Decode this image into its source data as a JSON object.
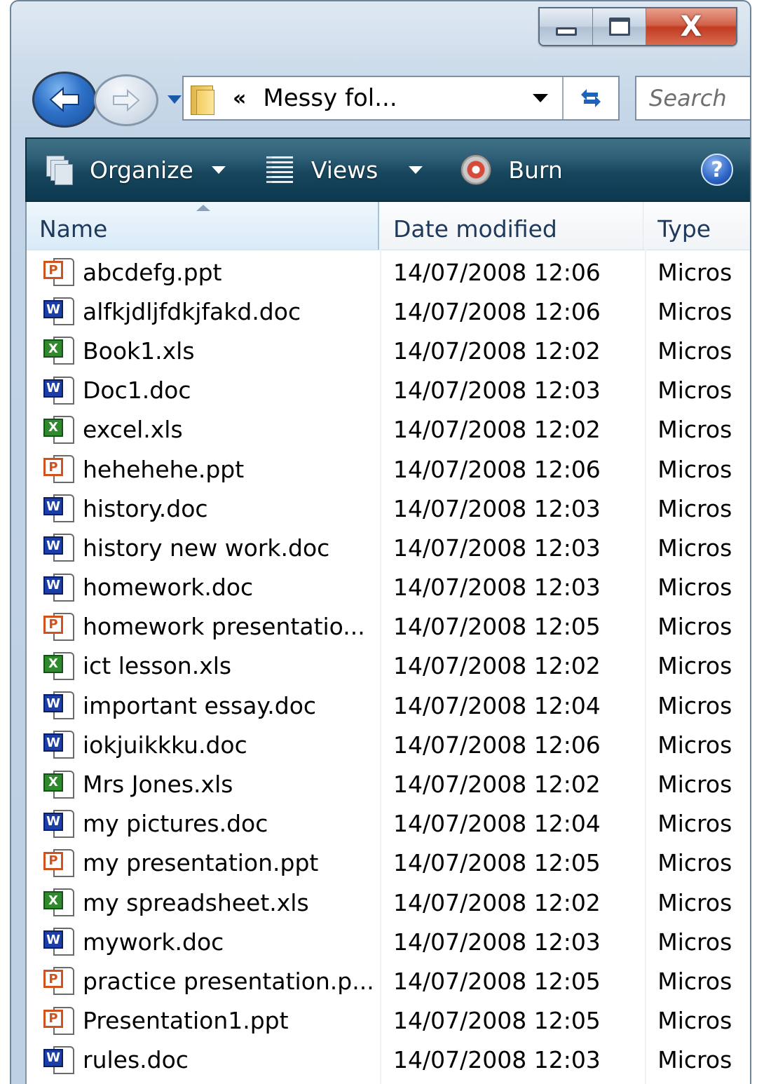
{
  "window": {
    "caption": {
      "minimize_icon": "minimize-icon",
      "maximize_icon": "maximize-icon",
      "close_glyph": "X"
    }
  },
  "nav": {
    "back_icon": "arrow-left-icon",
    "forward_icon": "arrow-right-icon",
    "address_chevron": "«",
    "address_text": "Messy fol...",
    "search_placeholder": "Search"
  },
  "toolbar": {
    "organize_label": "Organize",
    "views_label": "Views",
    "burn_label": "Burn",
    "help_glyph": "?"
  },
  "columns": {
    "name": "Name",
    "date": "Date modified",
    "type": "Type"
  },
  "files": [
    {
      "icon": "ppt",
      "name": "abcdefg.ppt",
      "date": "14/07/2008 12:06",
      "type": "Micros"
    },
    {
      "icon": "doc",
      "name": "alfkjdljfdkjfakd.doc",
      "date": "14/07/2008 12:06",
      "type": "Micros"
    },
    {
      "icon": "xls",
      "name": "Book1.xls",
      "date": "14/07/2008 12:02",
      "type": "Micros"
    },
    {
      "icon": "doc",
      "name": "Doc1.doc",
      "date": "14/07/2008 12:03",
      "type": "Micros"
    },
    {
      "icon": "xls",
      "name": "excel.xls",
      "date": "14/07/2008 12:02",
      "type": "Micros"
    },
    {
      "icon": "ppt",
      "name": "hehehehe.ppt",
      "date": "14/07/2008 12:06",
      "type": "Micros"
    },
    {
      "icon": "doc",
      "name": "history.doc",
      "date": "14/07/2008 12:03",
      "type": "Micros"
    },
    {
      "icon": "doc",
      "name": "history new work.doc",
      "date": "14/07/2008 12:03",
      "type": "Micros"
    },
    {
      "icon": "doc",
      "name": "homework.doc",
      "date": "14/07/2008 12:03",
      "type": "Micros"
    },
    {
      "icon": "ppt",
      "name": "homework presentatio...",
      "date": "14/07/2008 12:05",
      "type": "Micros"
    },
    {
      "icon": "xls",
      "name": "ict lesson.xls",
      "date": "14/07/2008 12:02",
      "type": "Micros"
    },
    {
      "icon": "doc",
      "name": "important essay.doc",
      "date": "14/07/2008 12:04",
      "type": "Micros"
    },
    {
      "icon": "doc",
      "name": "iokjuikkku.doc",
      "date": "14/07/2008 12:06",
      "type": "Micros"
    },
    {
      "icon": "xls",
      "name": "Mrs Jones.xls",
      "date": "14/07/2008 12:02",
      "type": "Micros"
    },
    {
      "icon": "doc",
      "name": "my pictures.doc",
      "date": "14/07/2008 12:04",
      "type": "Micros"
    },
    {
      "icon": "ppt",
      "name": "my presentation.ppt",
      "date": "14/07/2008 12:05",
      "type": "Micros"
    },
    {
      "icon": "xls",
      "name": "my spreadsheet.xls",
      "date": "14/07/2008 12:02",
      "type": "Micros"
    },
    {
      "icon": "doc",
      "name": "mywork.doc",
      "date": "14/07/2008 12:03",
      "type": "Micros"
    },
    {
      "icon": "ppt",
      "name": "practice presentation.p...",
      "date": "14/07/2008 12:05",
      "type": "Micros"
    },
    {
      "icon": "ppt",
      "name": "Presentation1.ppt",
      "date": "14/07/2008 12:05",
      "type": "Micros"
    },
    {
      "icon": "doc",
      "name": "rules.doc",
      "date": "14/07/2008 12:03",
      "type": "Micros"
    }
  ],
  "icon_glyphs": {
    "doc": "W",
    "xls": "X",
    "ppt": "P"
  },
  "colors": {
    "toolbar_top": "#3f7186",
    "toolbar_bottom": "#0c3950",
    "doc_icon": "#1c3ea8",
    "xls_icon": "#2f8a2c",
    "ppt_icon": "#d0531f"
  }
}
